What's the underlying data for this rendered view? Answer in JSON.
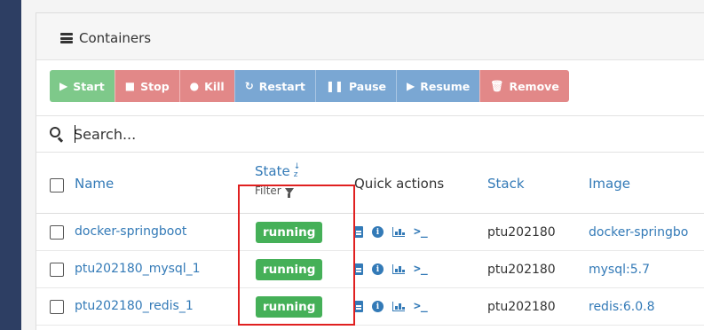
{
  "panel": {
    "title": "Containers",
    "title_icon": "server-icon"
  },
  "toolbar": {
    "buttons": [
      {
        "label": "Start",
        "icon": "play-icon"
      },
      {
        "label": "Stop",
        "icon": "stop-icon"
      },
      {
        "label": "Kill",
        "icon": "bomb-icon"
      },
      {
        "label": "Restart",
        "icon": "refresh-icon"
      },
      {
        "label": "Pause",
        "icon": "pause-icon"
      },
      {
        "label": "Resume",
        "icon": "play-icon"
      },
      {
        "label": "Remove",
        "icon": "trash-icon"
      }
    ]
  },
  "search": {
    "placeholder": "Search..."
  },
  "table": {
    "columns": {
      "name": "Name",
      "state": "State",
      "state_filter": "Filter",
      "quick_actions": "Quick actions",
      "stack": "Stack",
      "image": "Image"
    },
    "rows": [
      {
        "name": "docker-springboot",
        "state": "running",
        "stack": "ptu202180",
        "image": "docker-springbo"
      },
      {
        "name": "ptu202180_mysql_1",
        "state": "running",
        "stack": "ptu202180",
        "image": "mysql:5.7"
      },
      {
        "name": "ptu202180_redis_1",
        "state": "running",
        "stack": "ptu202180",
        "image": "redis:6.0.8"
      }
    ]
  },
  "colors": {
    "sidebar": "#2d3e63",
    "link": "#337ab7",
    "running_badge": "#45b058",
    "start_button": "#7ec98a",
    "danger_button": "#e28888",
    "primary_button": "#7aa7d3",
    "annotation_box": "#e02020"
  }
}
